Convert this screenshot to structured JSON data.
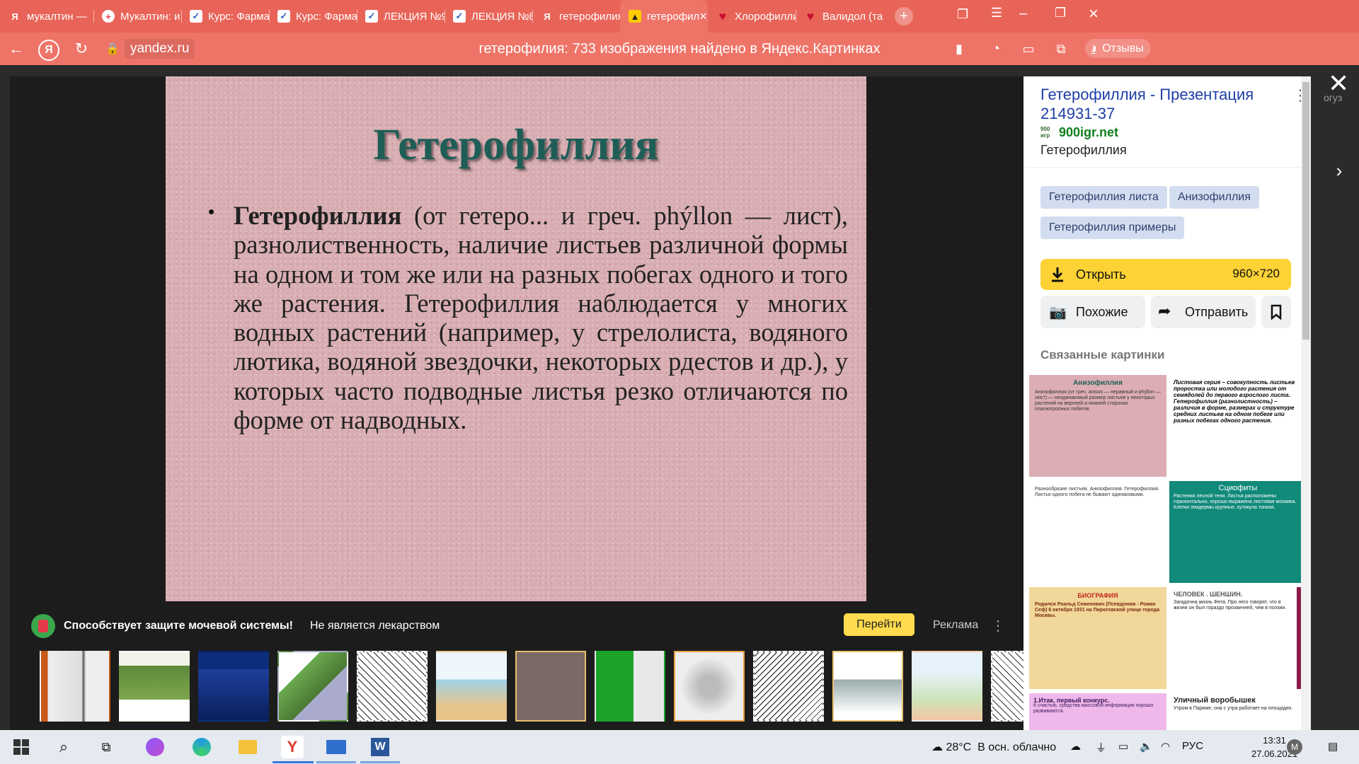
{
  "tabs": [
    {
      "label": "мукалтин —",
      "icon": "yandex-icon"
    },
    {
      "label": "Мукалтин: и",
      "icon": "medical-cross-icon"
    },
    {
      "label": "Курс: Фарма",
      "icon": "check-shield-icon"
    },
    {
      "label": "Курс: Фарма",
      "icon": "check-shield-icon"
    },
    {
      "label": "ЛЕКЦИЯ №9",
      "icon": "check-shield-icon"
    },
    {
      "label": "ЛЕКЦИЯ №8",
      "icon": "check-shield-icon"
    },
    {
      "label": "гетерофилия",
      "icon": "yandex-icon"
    },
    {
      "label": "гетерофил",
      "icon": "yandex-images-icon",
      "active": true
    },
    {
      "label": "Хлорофилли",
      "icon": "heart-icon"
    },
    {
      "label": "Валидол (таб",
      "icon": "heart-icon"
    }
  ],
  "address": {
    "host": "yandex.ru",
    "page_title": "гетерофилия: 733 изображения найдено в Яндекс.Картинках",
    "reviews_label": "Отзывы"
  },
  "slide": {
    "title": "Гетерофиллия",
    "bullet": "•",
    "term": "Гетерофиллия",
    "body": " (от гетеро... и греч. phýllon — лист), разнолиственность, наличие листьев различной формы на одном и том же или на разных побегах одного и того же растения. Гетерофиллия наблюдается у многих водных растений (например, у стрелолиста, водяного лютика, водяной звездочки, некоторых рдестов и др.), у которых часто подводные листья резко отличаются по форме от надводных."
  },
  "ad": {
    "title": "Способствует защите мочевой системы!",
    "subtitle": "Не является лекарством",
    "button": "Перейти",
    "label": "Реклама"
  },
  "panel": {
    "title": "Гетерофиллия - Презентация 214931-37",
    "logo_text": "900 игр",
    "site": "900igr.net",
    "description": "Гетерофиллия",
    "chips": [
      "Гетерофиллия листа",
      "Анизофиллия",
      "Гетерофиллия примеры"
    ],
    "open_label": "Открыть",
    "size": "960×720",
    "similar_label": "Похожие",
    "share_label": "Отправить",
    "related_title": "Связанные картинки",
    "related": [
      {
        "title": "Анизофиллия",
        "text": "Анизофиллия (от греч. anisos — неравный и phýllon — лист) — неодинаковый размер листьев у некоторых растений на верхней и нижней сторонах плагиотропных побегов."
      },
      {
        "title": "",
        "text": "Листовая серия – совокупность листьев проростка или молодого растения от семядолей до первого взрослого листа. Гетерофиллия (разнолистность) – различия в форме, размерах и структуре средних листьев на одном побеге или разных побегах одного растения."
      },
      {
        "title": "",
        "text": "Разнообразие листьев. Анизофиллия. Гетерофиллия. Листья одного побега не бывают одинаковыми."
      },
      {
        "title": "Сциофиты",
        "text": "Растения лесной тени. Листья расположены горизонтально, хорошо выражена листовая мозаика. Клетки эпидермы крупные, кутикула тонкая."
      },
      {
        "title": "БИОГРАФИЯ",
        "text": "Родился Роальд Семенович (Псевдоним - Роман Сеф) 6 октября 1931 на Пироговской улице города Москвы."
      },
      {
        "title": "ЧЕЛОВЕК . ШЕНШИН.",
        "text": "Загадочна жизнь Фета. Про него говорят, что в жизни он был гораздо прозаичней, чем в поэзии."
      },
      {
        "title": "1.Итак, первый конкурс.",
        "text": "К счастью, средства массовой информации хорошо развиваются."
      },
      {
        "title": "Уличный воробышек",
        "text": "Утром в Париже, она с утра работает на площадях."
      }
    ]
  },
  "side": {
    "hint": "огуз"
  },
  "taskbar": {
    "temperature": "28°C",
    "weather": "В осн. облачно",
    "lang": "РУС",
    "time": "13:31",
    "date": "27.06.2021"
  }
}
